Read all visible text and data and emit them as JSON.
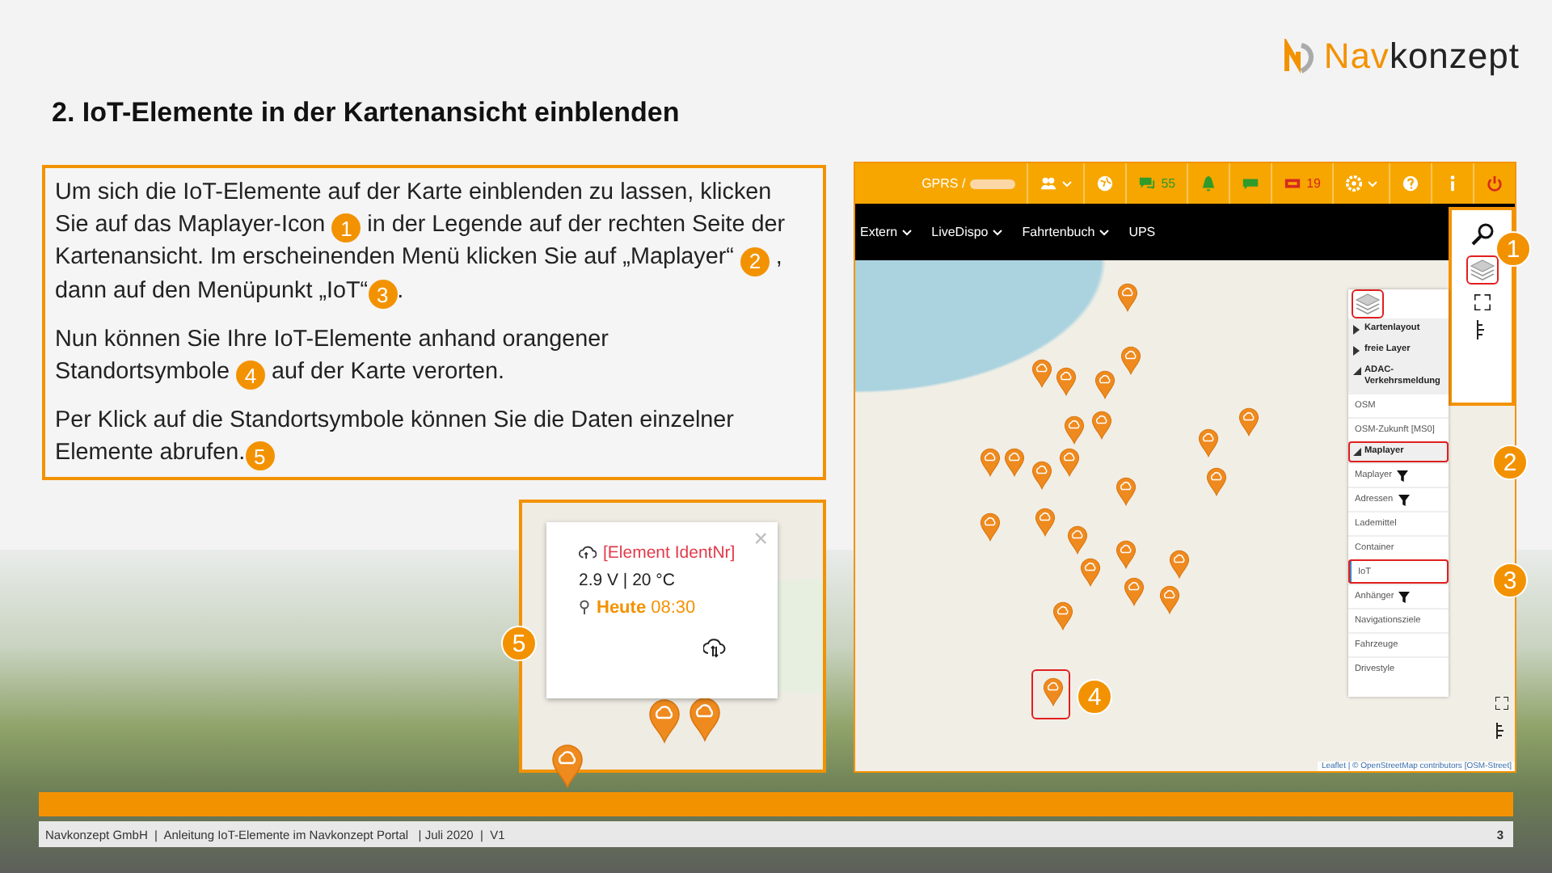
{
  "logo": {
    "accent": "Nav",
    "rest": "konzept"
  },
  "title": "2. IoT-Elemente in der Kartenansicht einblenden",
  "instructions": {
    "paragraphs": [
      {
        "segments": [
          {
            "kind": "text",
            "text": "Um sich die IoT-Elemente auf der Karte einblenden zu lassen, klicken Sie auf das Maplayer-Icon "
          },
          {
            "kind": "badge",
            "text": "1"
          },
          {
            "kind": "text",
            "text": " in der Legende auf der rechten Seite der Kartenansicht. Im erscheinenden Menü klicken Sie auf „Maplayer“ "
          },
          {
            "kind": "badge",
            "text": "2"
          },
          {
            "kind": "text",
            "text": " , dann auf den Menüpunkt „IoT“"
          },
          {
            "kind": "badge",
            "text": "3"
          },
          {
            "kind": "text",
            "text": "."
          }
        ]
      },
      {
        "segments": [
          {
            "kind": "text",
            "text": "Nun können Sie Ihre IoT-Elemente anhand orangener Standortsymbole "
          },
          {
            "kind": "badge",
            "text": "4"
          },
          {
            "kind": "text",
            "text": " auf der Karte verorten."
          }
        ]
      },
      {
        "segments": [
          {
            "kind": "text",
            "text": "Per Klick auf die Standortsymbole können Sie die Daten einzelner Elemente abrufen."
          },
          {
            "kind": "badge",
            "text": "5"
          }
        ]
      }
    ]
  },
  "popup_inset": {
    "callout": "5",
    "popup": {
      "title": "[Element IdentNr]",
      "reading": "2.9 V | 20 °C",
      "last_seen": "**Heute** 08:30",
      "close": "×"
    }
  },
  "screenshot": {
    "toolbar": {
      "account_label": "GPRS /",
      "message_count": "55",
      "alert_count": "19"
    },
    "menu_bar": [
      {
        "label": "Extern",
        "dropdown": true
      },
      {
        "label": "LiveDispo",
        "dropdown": true
      },
      {
        "label": "Fahrtenbuch",
        "dropdown": true
      },
      {
        "label": "UPS",
        "dropdown": false
      }
    ],
    "layer_menu": [
      {
        "kind": "group",
        "label": "Kartenlayout",
        "expanded": false,
        "highlighted": false
      },
      {
        "kind": "group",
        "label": "freie Layer",
        "expanded": false,
        "highlighted": false
      },
      {
        "kind": "group",
        "label": "ADAC-Verkehrsmeldung",
        "expanded": true,
        "highlighted": false
      },
      {
        "kind": "item",
        "label": "OSM",
        "selected": false,
        "highlighted": false,
        "filter": false
      },
      {
        "kind": "item",
        "label": "OSM-Zukunft [MS0]",
        "selected": false,
        "highlighted": false,
        "filter": false
      },
      {
        "kind": "group",
        "label": "Maplayer",
        "expanded": true,
        "highlighted": true
      },
      {
        "kind": "item",
        "label": "Maplayer",
        "selected": false,
        "highlighted": false,
        "filter": true
      },
      {
        "kind": "item",
        "label": "Adressen",
        "selected": false,
        "highlighted": false,
        "filter": true
      },
      {
        "kind": "item",
        "label": "Lademittel",
        "selected": false,
        "highlighted": false,
        "filter": false
      },
      {
        "kind": "item",
        "label": "Container",
        "selected": false,
        "highlighted": false,
        "filter": false
      },
      {
        "kind": "item",
        "label": "IoT",
        "selected": true,
        "highlighted": true,
        "filter": false
      },
      {
        "kind": "item",
        "label": "Anhänger",
        "selected": false,
        "highlighted": false,
        "filter": true
      },
      {
        "kind": "item",
        "label": "Navigationsziele",
        "selected": false,
        "highlighted": false,
        "filter": false
      },
      {
        "kind": "item",
        "label": "Fahrzeuge",
        "selected": false,
        "highlighted": false,
        "filter": false
      },
      {
        "kind": "item",
        "label": "Drivestyle",
        "selected": false,
        "highlighted": false,
        "filter": false
      }
    ],
    "attribution": "Leaflet | © OpenStreetMap contributors [OSM-Street]",
    "callouts": [
      "1",
      "2",
      "3",
      "4"
    ]
  },
  "footer": {
    "text": "Navkonzept GmbH  |  Anleitung IoT-Elemente im Navkonzept Portal   | Juli 2020  |  V1",
    "page": "3"
  }
}
